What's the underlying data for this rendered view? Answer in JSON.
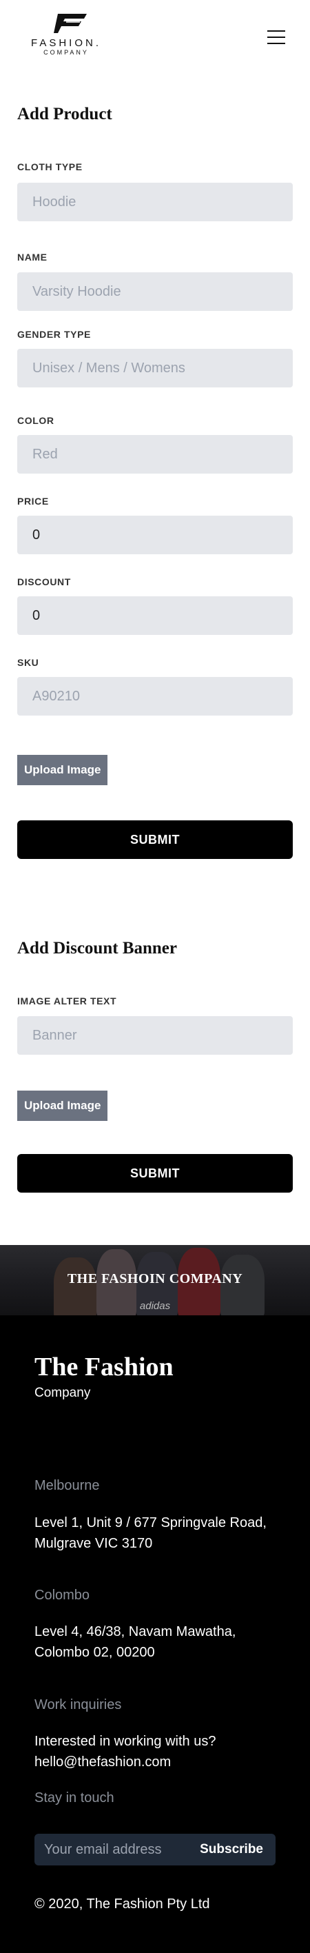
{
  "header": {
    "logo_word": "FASHION.",
    "logo_sub": "COMPANY",
    "menu_icon": "hamburger-menu-icon"
  },
  "add_product": {
    "title": "Add Product",
    "fields": [
      {
        "label": "CLOTH TYPE",
        "placeholder": "Hoodie",
        "value": ""
      },
      {
        "label": "NAME",
        "placeholder": "Varsity Hoodie",
        "value": ""
      },
      {
        "label": "GENDER TYPE",
        "placeholder": "Unisex / Mens / Womens",
        "value": ""
      },
      {
        "label": "COLOR",
        "placeholder": "Red",
        "value": ""
      },
      {
        "label": "PRICE",
        "placeholder": "",
        "value": "0"
      },
      {
        "label": "DISCOUNT",
        "placeholder": "",
        "value": "0"
      },
      {
        "label": "SKU",
        "placeholder": "A90210",
        "value": ""
      }
    ],
    "upload_label": "Upload Image",
    "submit_label": "SUBMIT"
  },
  "add_banner": {
    "title": "Add Discount Banner",
    "fields": [
      {
        "label": "IMAGE ALTER TEXT",
        "placeholder": "Banner",
        "value": ""
      }
    ],
    "upload_label": "Upload Image",
    "submit_label": "SUBMIT"
  },
  "footer": {
    "banner_title": "THE FASHOIN COMPANY",
    "banner_brand": "adidas",
    "brand": "The Fashion",
    "brand_sub": "Company",
    "melbourne_label": "Melbourne",
    "melbourne_address": "Level 1, Unit 9 / 677 Springvale Road, Mulgrave VIC 3170",
    "colombo_label": "Colombo",
    "colombo_address": "Level 4, 46/38, Navam Mawatha, Colombo 02, 00200",
    "work_label": "Work inquiries",
    "work_text": "Interested in working with us?",
    "work_email": "hello@thefashion.com",
    "stay_label": "Stay in touch",
    "email_placeholder": "Your email address",
    "subscribe_label": "Subscribe",
    "copyright": "© 2020, The Fashion Pty Ltd"
  },
  "colors": {
    "input_bg": "#e5e7eb",
    "upload_bg": "#6b7280",
    "submit_bg": "#000000",
    "footer_bg": "#000000",
    "muted_text": "#8a8f98"
  }
}
